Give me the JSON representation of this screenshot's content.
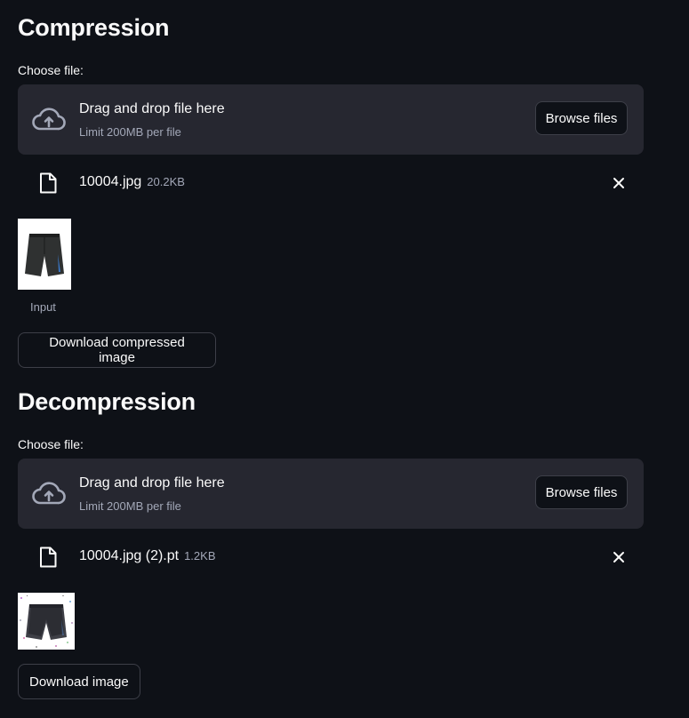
{
  "compression": {
    "title": "Compression",
    "choose_label": "Choose file:",
    "dropzone": {
      "title": "Drag and drop file here",
      "limit": "Limit 200MB per file",
      "browse_label": "Browse files"
    },
    "file": {
      "name": "10004.jpg",
      "size": "20.2KB"
    },
    "image_caption": "Input",
    "download_label": "Download compressed image"
  },
  "decompression": {
    "title": "Decompression",
    "choose_label": "Choose file:",
    "dropzone": {
      "title": "Drag and drop file here",
      "limit": "Limit 200MB per file",
      "browse_label": "Browse files"
    },
    "file": {
      "name": "10004.jpg (2).pt",
      "size": "1.2KB"
    },
    "download_label": "Download image"
  },
  "colors": {
    "background": "#0e1117",
    "dropzone": "#262730",
    "text": "#fafafa",
    "muted_text": "#a3a8b8",
    "button_border": "#3d3f48"
  },
  "icons": {
    "upload": "cloud-upload-icon",
    "file": "file-icon",
    "remove": "close-icon"
  }
}
